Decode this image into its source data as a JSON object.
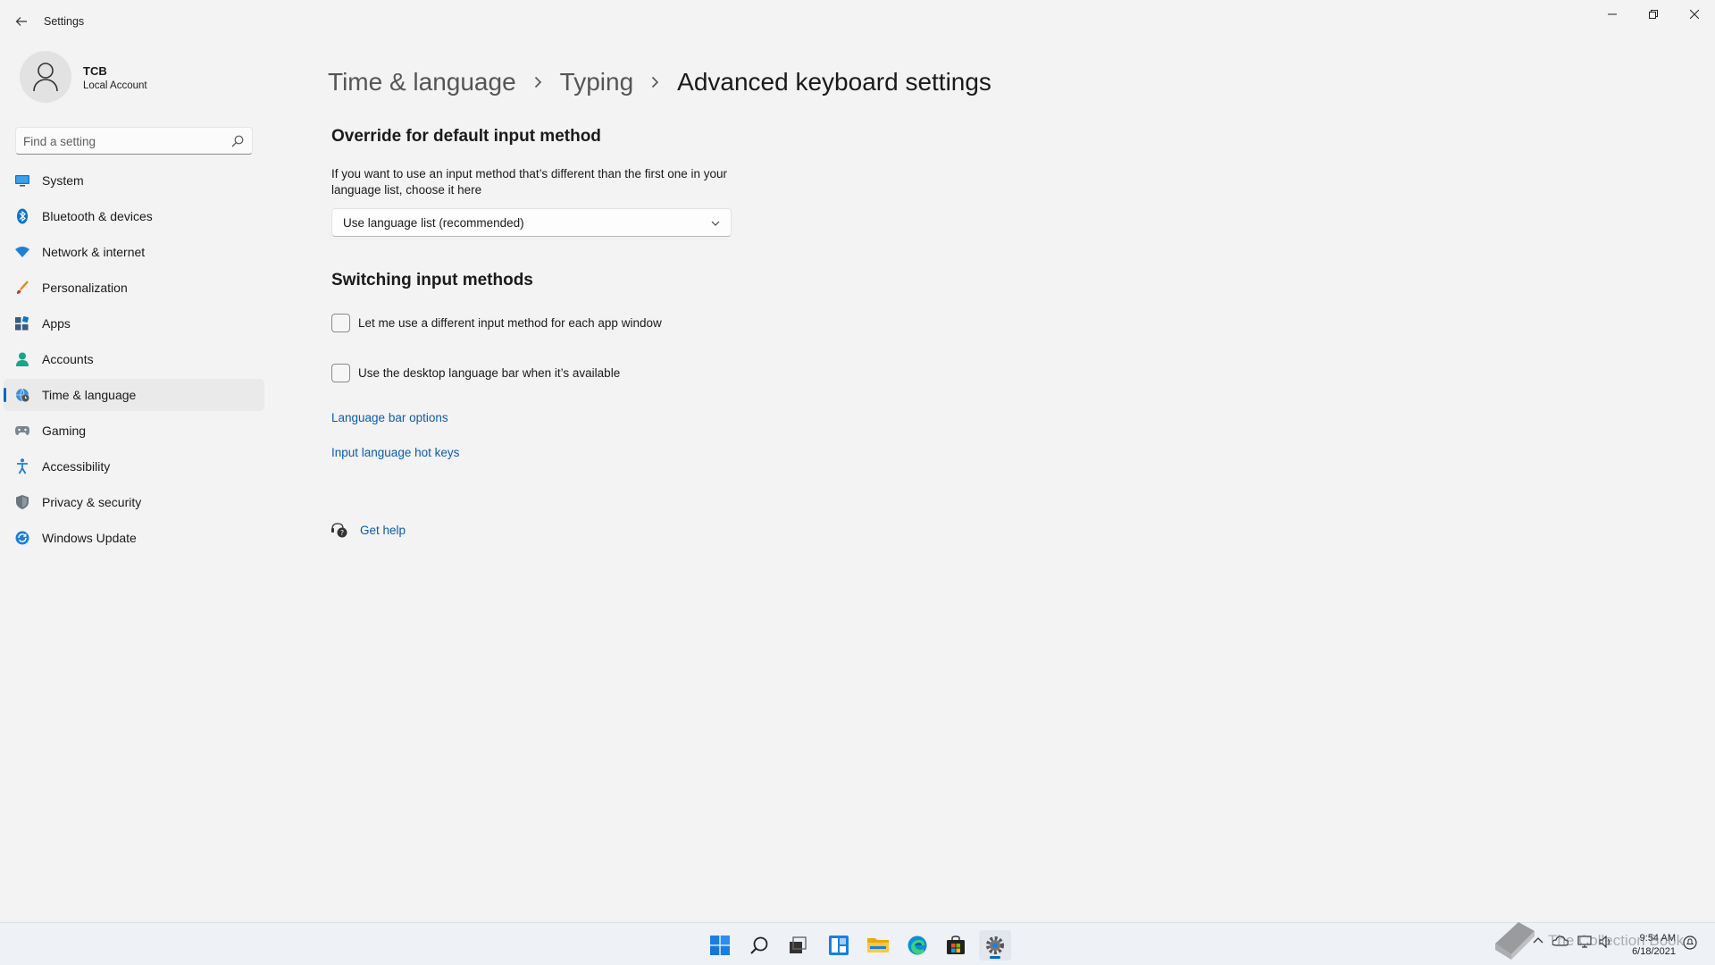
{
  "window": {
    "title": "Settings",
    "minimize_glyph": "—",
    "maximize_glyph": "❐",
    "close_glyph": "✕"
  },
  "user": {
    "name": "TCB",
    "account_type": "Local Account"
  },
  "search": {
    "placeholder": "Find a setting"
  },
  "sidebar": {
    "items": [
      {
        "label": "System",
        "icon": "monitor-icon"
      },
      {
        "label": "Bluetooth & devices",
        "icon": "bluetooth-icon"
      },
      {
        "label": "Network & internet",
        "icon": "wifi-icon"
      },
      {
        "label": "Personalization",
        "icon": "brush-icon"
      },
      {
        "label": "Apps",
        "icon": "apps-icon"
      },
      {
        "label": "Accounts",
        "icon": "person-icon"
      },
      {
        "label": "Time & language",
        "icon": "globe-clock-icon"
      },
      {
        "label": "Gaming",
        "icon": "gamepad-icon"
      },
      {
        "label": "Accessibility",
        "icon": "accessibility-icon"
      },
      {
        "label": "Privacy & security",
        "icon": "shield-icon"
      },
      {
        "label": "Windows Update",
        "icon": "update-icon"
      }
    ],
    "active_index": 6
  },
  "breadcrumb": {
    "items": [
      "Time & language",
      "Typing"
    ],
    "current": "Advanced keyboard settings"
  },
  "override": {
    "title": "Override for default input method",
    "description": "If you want to use an input method that’s different than the first one in your language list, choose it here",
    "selected": "Use language list (recommended)"
  },
  "switching": {
    "title": "Switching input methods",
    "options": [
      {
        "label": "Let me use a different input method for each app window",
        "checked": false
      },
      {
        "label": "Use the desktop language bar when it’s available",
        "checked": false
      }
    ]
  },
  "links": {
    "language_bar_options": "Language bar options",
    "hot_keys": "Input language hot keys",
    "get_help": "Get help"
  },
  "taskbar": {
    "apps": [
      "start-icon",
      "search-icon",
      "task-view-icon",
      "widgets-icon",
      "file-explorer-icon",
      "edge-icon",
      "store-icon",
      "settings-icon"
    ],
    "time": "9:54 AM",
    "date": "6/18/2021",
    "watermark": "The Collection Book"
  },
  "colors": {
    "accent": "#0067c0",
    "link": "#0b5cad",
    "background": "#f3f3f3"
  }
}
